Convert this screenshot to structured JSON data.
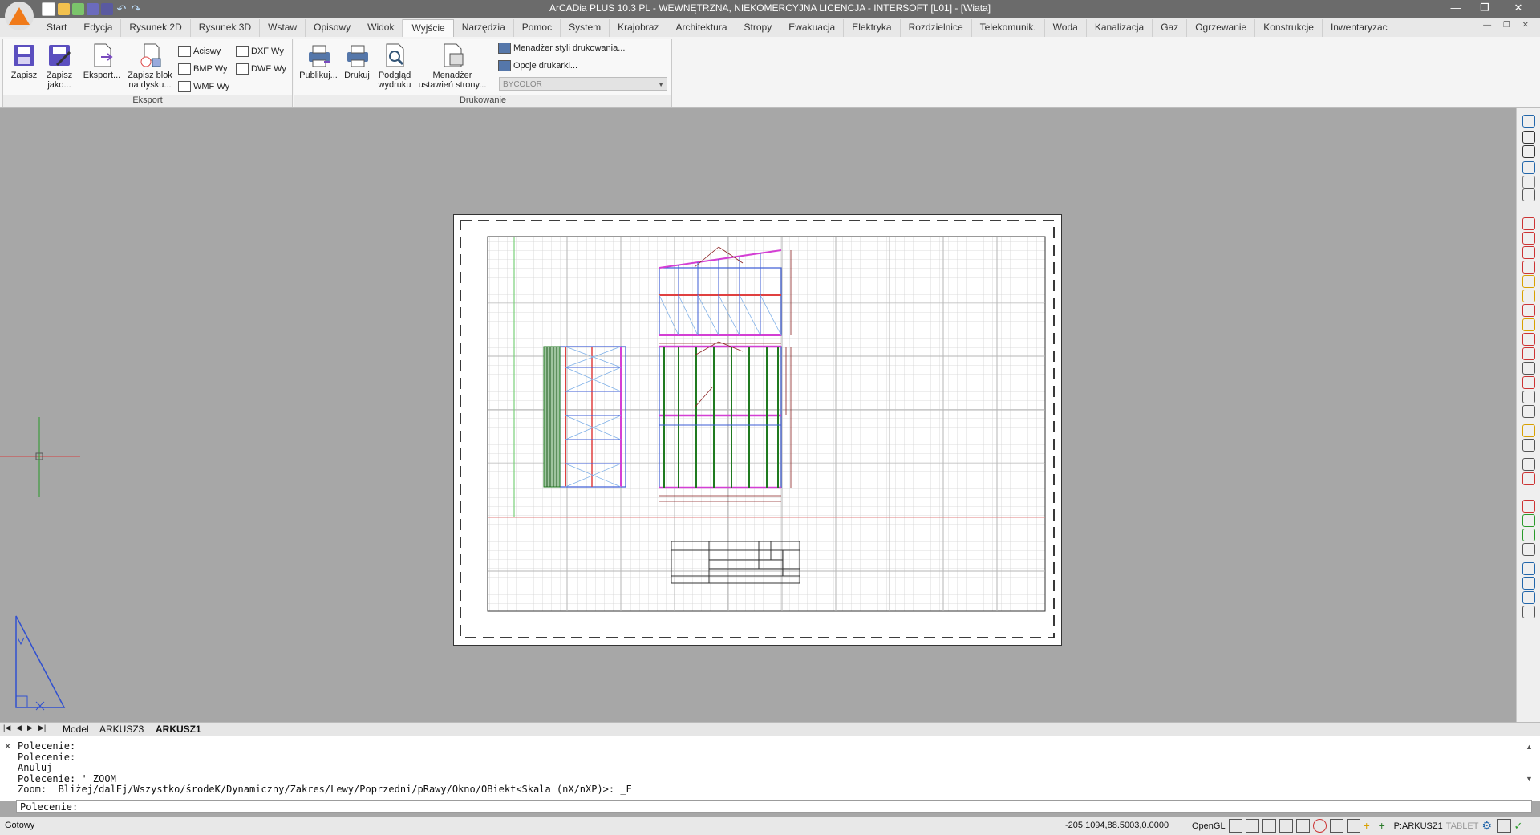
{
  "titlebar": {
    "title": "ArCADia PLUS 10.3 PL - WEWNĘTRZNA, NIEKOMERCYJNA LICENCJA - INTERSOFT [L01] - [Wiata]",
    "controls": {
      "minimize": "—",
      "restore": "❐",
      "close": "✕"
    }
  },
  "ribbon_tabs": [
    "Start",
    "Edycja",
    "Rysunek 2D",
    "Rysunek 3D",
    "Wstaw",
    "Opisowy",
    "Widok",
    "Wyjście",
    "Narzędzia",
    "Pomoc",
    "System",
    "Krajobraz",
    "Architektura",
    "Stropy",
    "Ewakuacja",
    "Elektryka",
    "Rozdzielnice",
    "Telekomunik.",
    "Woda",
    "Kanalizacja",
    "Gaz",
    "Ogrzewanie",
    "Konstrukcje",
    "Inwentaryzac"
  ],
  "active_tab": "Wyjście",
  "eksport": {
    "title": "Eksport",
    "zapisz": "Zapisz",
    "zapisz_jako_1": "Zapisz",
    "zapisz_jako_2": "jako...",
    "eksport": "Eksport...",
    "zapisz_blok_1": "Zapisz blok",
    "zapisz_blok_2": "na dysku...",
    "acis": "Aciswy",
    "bmp": "BMP Wy",
    "wmf": "WMF Wy",
    "dxf": "DXF Wy",
    "dwf": "DWF Wy"
  },
  "drukowanie": {
    "title": "Drukowanie",
    "publikuj": "Publikuj...",
    "drukuj": "Drukuj",
    "podglad_1": "Podgląd",
    "podglad_2": "wydruku",
    "menadzer_1": "Menadżer",
    "menadzer_2": "ustawień strony...",
    "style": "Menadżer styli drukowania...",
    "opcje": "Opcje drukarki...",
    "combo": "BYCOLOR"
  },
  "layout_tabs": {
    "model": "Model",
    "arkusz3": "ARKUSZ3",
    "arkusz1": "ARKUSZ1",
    "active": "ARKUSZ1"
  },
  "command": {
    "history": [
      "Polecenie:",
      "Polecenie:",
      "Anuluj",
      "Polecenie: '_ZOOM",
      "Zoom:  Bliżej/dalEj/Wszystko/środeK/Dynamiczny/Zakres/Lewy/Poprzedni/pRawy/Okno/OBiekt<Skala (nX/nXP)>: _E"
    ],
    "prompt": "Polecenie:"
  },
  "status": {
    "ready": "Gotowy",
    "coords": "-205.1094,88.5003,0.0000",
    "opengl": "OpenGL",
    "sheet": "P:ARKUSZ1",
    "tablet": "TABLET"
  },
  "colors": {
    "accent": "#f07a19",
    "magenta": "#d43fd4",
    "blue": "#3b5bd6",
    "green": "#1f7a1f",
    "red_axis": "#e04040"
  }
}
